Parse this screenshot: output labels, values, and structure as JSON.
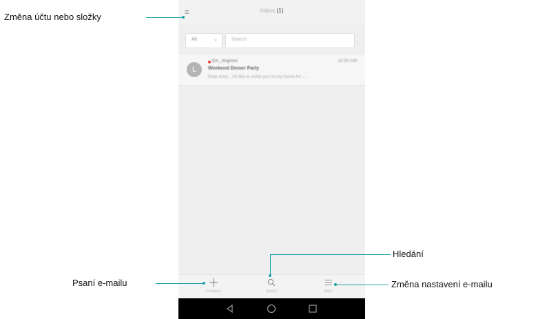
{
  "callouts": {
    "account_folder": "Změna účtu nebo složky",
    "search": "Hledání",
    "compose": "Psaní e-mailu",
    "settings": "Změna nastavení e-mailu"
  },
  "header": {
    "title": "Inbox",
    "count": "(1)",
    "menu_icon": "hamburger-icon"
  },
  "filter": {
    "selected": "All",
    "search_placeholder": "Search"
  },
  "mail": {
    "avatar_letter": "L",
    "sender": "Ein_Jingmini",
    "time": "10:50 AM",
    "subject": "Weekend Dinner Party",
    "preview": "Dear Amy... I'd like to invite you to my home for ..."
  },
  "toolbar": {
    "compose_label": "Compose",
    "search_label": "Search",
    "menu_label": "More"
  },
  "colors": {
    "accent": "#1fa3a8",
    "unread": "#e8432f"
  }
}
